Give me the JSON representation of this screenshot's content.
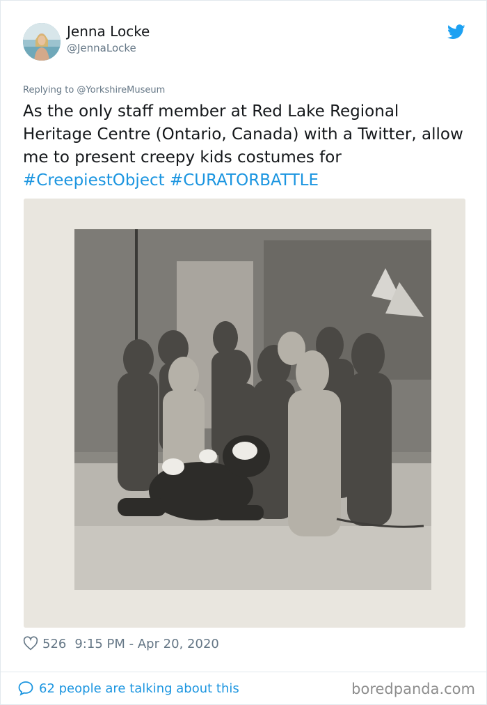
{
  "author": {
    "name": "Jenna Locke",
    "handle": "@JennaLocke"
  },
  "reply_to": "Replying to @YorkshireMuseum",
  "tweet_text": "As the only staff member at Red Lake Regional Heritage Centre (Ontario, Canada) with a Twitter, allow me to present creepy kids costumes for",
  "hashtags": "#CreepiestObject #CURATORBATTLE",
  "stats": {
    "likes": "526",
    "timestamp": "9:15 PM - Apr 20, 2020"
  },
  "footer": {
    "talking": "62 people are talking about this",
    "brand": "boredpanda.com"
  },
  "colors": {
    "accent": "#1b95e0",
    "muted": "#657786",
    "text": "#14171a",
    "border": "#e1e8ed"
  },
  "icons": [
    "twitter-bird-icon",
    "heart-icon",
    "speech-bubble-icon"
  ]
}
